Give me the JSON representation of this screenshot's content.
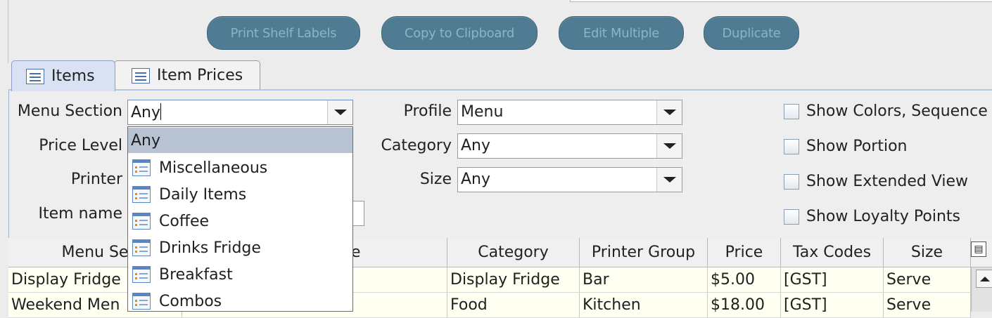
{
  "toolbar": {
    "buttons": [
      "Print Shelf Labels",
      "Copy to Clipboard",
      "Edit Multiple",
      "Duplicate"
    ]
  },
  "tabs": [
    {
      "label": "Items",
      "active": true
    },
    {
      "label": "Item Prices",
      "active": false
    }
  ],
  "filters": {
    "menu_section": {
      "label": "Menu Section",
      "value": "Any"
    },
    "price_level": {
      "label": "Price Level"
    },
    "printer": {
      "label": "Printer"
    },
    "item_name": {
      "label": "Item name",
      "value": ""
    },
    "profile": {
      "label": "Profile",
      "value": "Menu"
    },
    "category": {
      "label": "Category",
      "value": "Any"
    },
    "size": {
      "label": "Size",
      "value": "Any"
    }
  },
  "options": {
    "show_colors": {
      "label": "Show Colors, Sequence",
      "checked": false
    },
    "show_portion": {
      "label": "Show Portion",
      "checked": false
    },
    "show_extended": {
      "label": "Show Extended View",
      "checked": false
    },
    "show_loyalty": {
      "label": "Show Loyalty Points",
      "checked": false
    }
  },
  "menu_section_dropdown": {
    "selected": "Any",
    "items": [
      "Miscellaneous",
      "Daily Items",
      "Coffee",
      "Drinks Fridge",
      "Breakfast",
      "Combos"
    ]
  },
  "table": {
    "columns": [
      "Menu Se",
      "e",
      "Category",
      "Printer Group",
      "Price",
      "Tax Codes",
      "Size"
    ],
    "rows": [
      [
        "Display Fridge",
        "",
        "Display Fridge",
        "Bar",
        "$5.00",
        "[GST]",
        "Serve"
      ],
      [
        "Weekend Men",
        "",
        "Food",
        "Kitchen",
        "$18.00",
        "[GST]",
        "Serve"
      ]
    ]
  },
  "colors": {
    "button_bg": "#4f7b93",
    "button_text": "#8eb3c8",
    "active_tab": "#d9e2f2",
    "row_bg": "#fffff2",
    "dropdown_selected": "#b7c3d3"
  }
}
